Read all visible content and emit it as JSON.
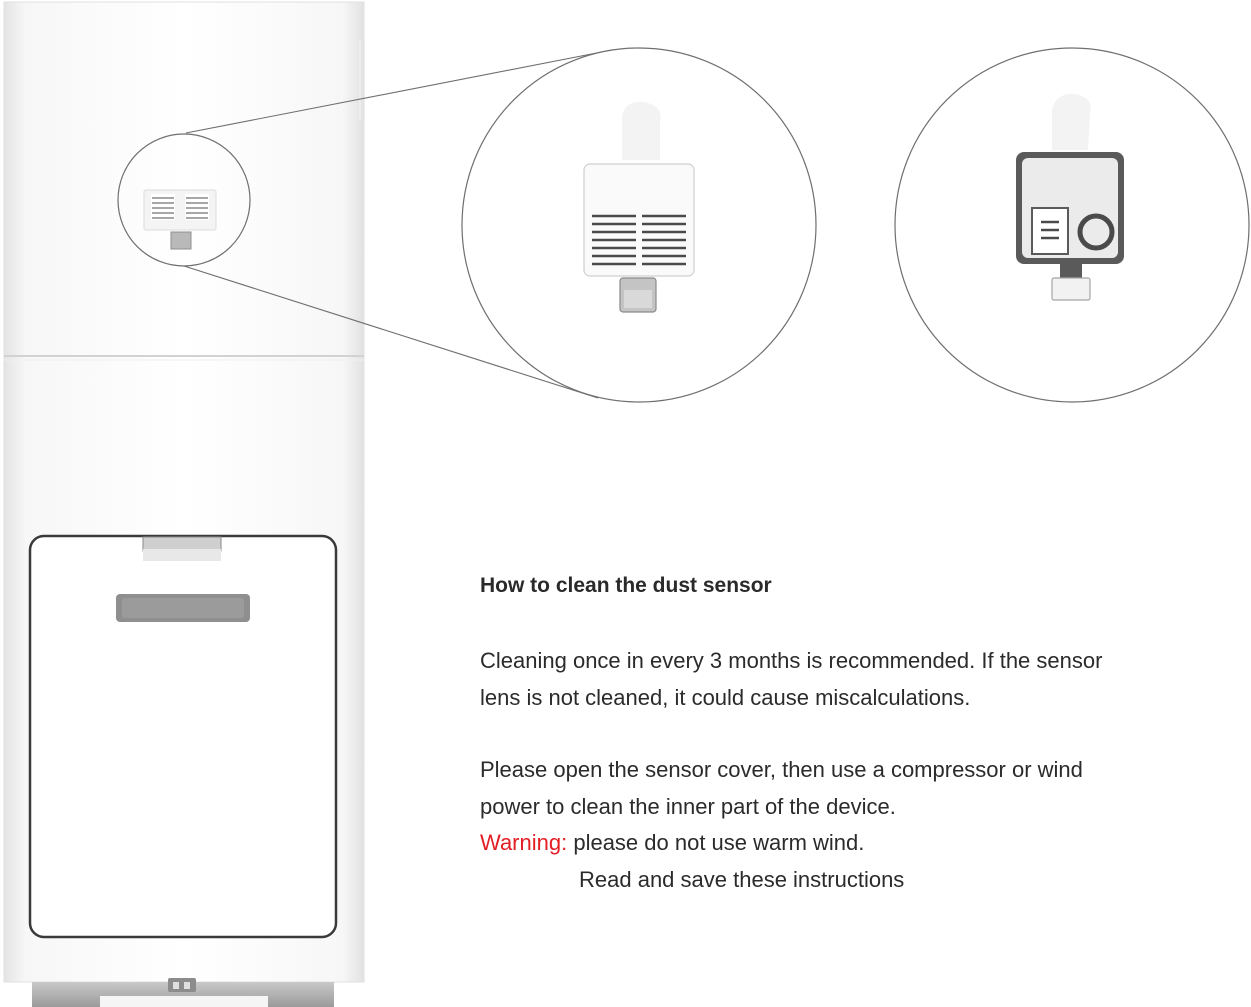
{
  "instructions": {
    "title": "How to clean the dust sensor",
    "paragraph1_line1": "Cleaning once in every 3 months is recommended. If the sensor",
    "paragraph1_line2": "lens is not cleaned, it could cause miscalculations.",
    "paragraph2_line1": "Please open the sensor cover, then use a compressor or wind",
    "paragraph2_line2": "power to clean the inner part of the device.",
    "warning_label": "Warning:",
    "warning_text": " please do not use warm wind.",
    "closing_note": "Read and save these instructions"
  },
  "colors": {
    "warning": "#e31e24",
    "text": "#2b2b2b",
    "device_body": "#ffffff",
    "device_edge": "#d9d9d9",
    "callout_line": "#666666"
  }
}
